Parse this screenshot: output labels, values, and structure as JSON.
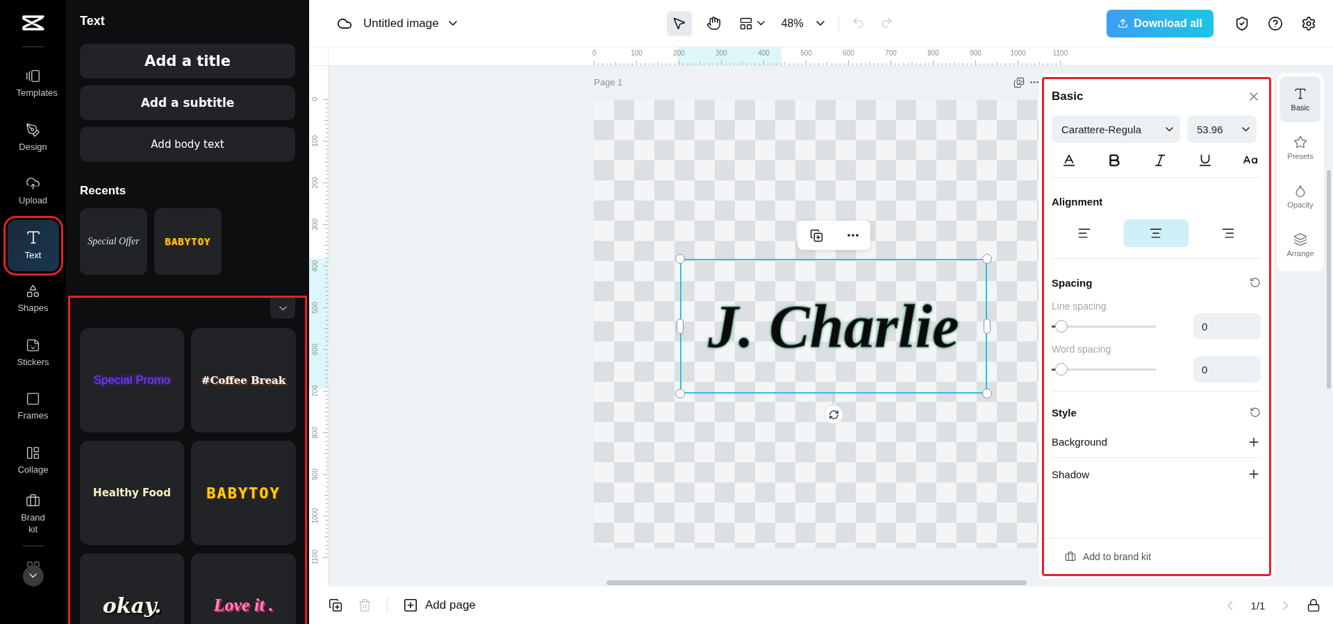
{
  "rail": {
    "items": [
      {
        "kind": "templates",
        "label": "Templates",
        "selected": false
      },
      {
        "kind": "design",
        "label": "Design",
        "selected": false
      },
      {
        "kind": "upload",
        "label": "Upload",
        "selected": false
      },
      {
        "kind": "text",
        "label": "Text",
        "selected": true
      },
      {
        "kind": "shapes",
        "label": "Shapes",
        "selected": false
      },
      {
        "kind": "stickers",
        "label": "Stickers",
        "selected": false
      },
      {
        "kind": "frames",
        "label": "Frames",
        "selected": false
      },
      {
        "kind": "collage",
        "label": "Collage",
        "selected": false
      },
      {
        "kind": "brand",
        "label": "Brand kit",
        "selected": false
      }
    ]
  },
  "text_panel": {
    "title": "Text",
    "add_buttons": [
      {
        "kind": "title",
        "label": "Add a title"
      },
      {
        "kind": "subtitle",
        "label": "Add a subtitle"
      },
      {
        "kind": "body",
        "label": "Add body text"
      }
    ],
    "recents_title": "Recents",
    "recents": [
      {
        "kind": "script",
        "label": "Special Offer"
      },
      {
        "kind": "block",
        "label": "BABYTOY"
      }
    ],
    "templates": [
      {
        "kind": "neon",
        "label": "Special Promo"
      },
      {
        "kind": "slab",
        "label": "#Coffee Break"
      },
      {
        "kind": "rounded",
        "label": "Healthy Food"
      },
      {
        "kind": "block",
        "label": "BABYTOY"
      },
      {
        "kind": "heavy",
        "label": "okay."
      },
      {
        "kind": "pink",
        "label": "Love it ."
      }
    ]
  },
  "topbar": {
    "title": "Untitled image",
    "zoom": "48%",
    "download": "Download all",
    "tools": [
      {
        "kind": "select",
        "selected": true
      },
      {
        "kind": "hand",
        "selected": false
      }
    ],
    "history": [
      {
        "kind": "undo",
        "disabled": true
      },
      {
        "kind": "redo",
        "disabled": true
      }
    ]
  },
  "ruler": {
    "x_labels": [
      "0",
      "100",
      "200",
      "300",
      "400",
      "500",
      "600",
      "700",
      "800",
      "900",
      "1000",
      "1100"
    ],
    "y_labels": [
      "0",
      "100",
      "200",
      "300",
      "400",
      "500",
      "600",
      "700",
      "800",
      "900",
      "1000",
      "1100"
    ]
  },
  "canvas": {
    "page_label": "Page 1",
    "text": "J. Charlie"
  },
  "bottom": {
    "add_page": "Add page",
    "page_count": "1/1",
    "delete_disabled": true,
    "prev_disabled": true,
    "next_disabled": true
  },
  "props": {
    "title": "Basic",
    "font": "Carattere-Regula",
    "size": "53.96",
    "format": [
      {
        "kind": "color"
      },
      {
        "kind": "bold"
      },
      {
        "kind": "italic"
      },
      {
        "kind": "underline"
      },
      {
        "kind": "case"
      }
    ],
    "alignment": {
      "title": "Alignment",
      "options": [
        {
          "kind": "left",
          "selected": false
        },
        {
          "kind": "center",
          "selected": true
        },
        {
          "kind": "right",
          "selected": false
        }
      ]
    },
    "spacing": {
      "title": "Spacing",
      "sliders": [
        {
          "label": "Line spacing",
          "level": 0.03,
          "value": "0"
        },
        {
          "label": "Word spacing",
          "level": 0.03,
          "value": "0"
        }
      ]
    },
    "style": {
      "title": "Style",
      "rows": [
        "Background",
        "Shadow"
      ]
    },
    "footer": "Add to brand kit"
  },
  "side_tabs": [
    {
      "kind": "basic",
      "label": "Basic",
      "selected": true
    },
    {
      "kind": "presets",
      "label": "Presets",
      "selected": false
    },
    {
      "kind": "opacity",
      "label": "Opacity",
      "selected": false
    },
    {
      "kind": "arrange",
      "label": "Arrange",
      "selected": false
    }
  ]
}
